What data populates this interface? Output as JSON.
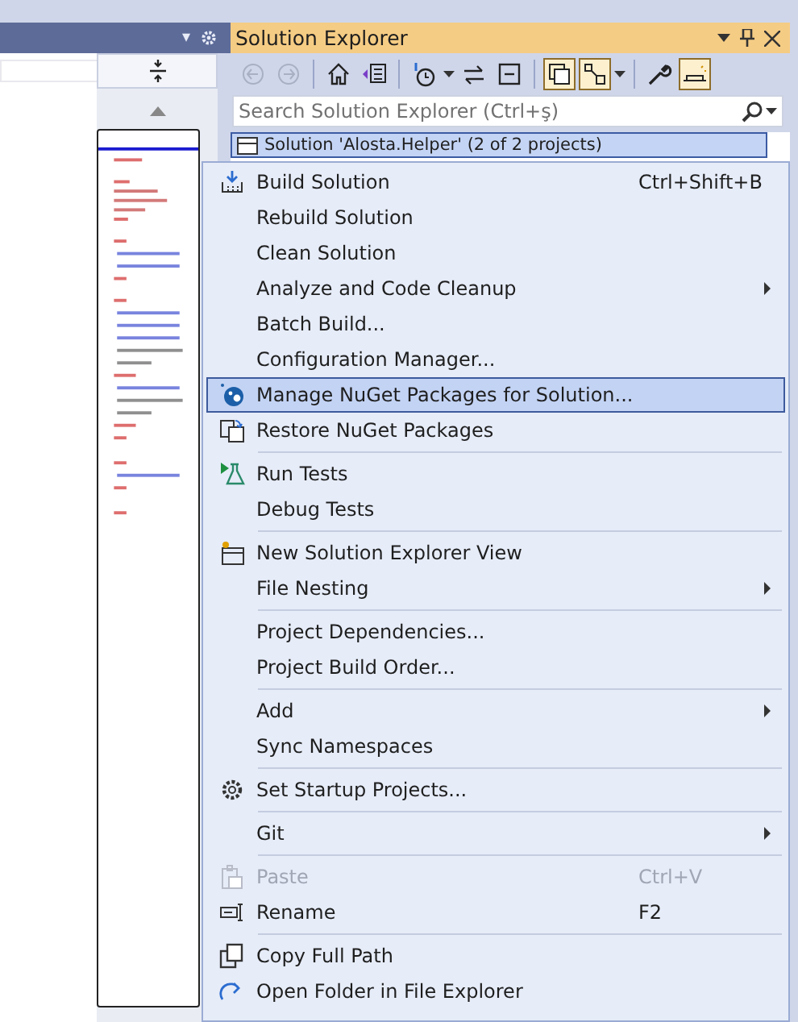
{
  "editor": {
    "tool_header": {
      "dropdown": "▾"
    }
  },
  "solution_explorer": {
    "title": "Solution Explorer",
    "toolbar": [
      {
        "kind": "back",
        "on": false,
        "disabled": true
      },
      {
        "kind": "forward",
        "on": false,
        "disabled": true
      },
      {
        "kind": "home",
        "on": false,
        "disabled": false
      },
      {
        "kind": "switch-views",
        "on": false,
        "disabled": false
      },
      {
        "kind": "history",
        "on": false,
        "disabled": false
      },
      {
        "kind": "sync",
        "on": false,
        "disabled": false
      },
      {
        "kind": "collapse",
        "on": false,
        "disabled": false
      },
      {
        "kind": "show-all",
        "on": true,
        "disabled": false
      },
      {
        "kind": "filter",
        "on": true,
        "disabled": false
      },
      {
        "kind": "properties",
        "on": false,
        "disabled": false
      },
      {
        "kind": "preview",
        "on": true,
        "disabled": false
      }
    ],
    "search": {
      "placeholder": "Search Solution Explorer (Ctrl+ş)"
    },
    "tree": [
      {
        "label": "Solution 'Alosta.Helper' (2 of 2 projects)",
        "selected": true
      }
    ]
  },
  "context_menu": {
    "items": [
      {
        "kind": "item",
        "label": "Build Solution",
        "shortcut": "Ctrl+Shift+B",
        "submenu": false,
        "disabled": false,
        "selected": false
      },
      {
        "kind": "item",
        "label": "Rebuild Solution",
        "submenu": false,
        "disabled": false,
        "selected": false
      },
      {
        "kind": "item",
        "label": "Clean Solution",
        "submenu": false,
        "disabled": false,
        "selected": false
      },
      {
        "kind": "item",
        "label": "Analyze and Code Cleanup",
        "submenu": true,
        "disabled": false,
        "selected": false
      },
      {
        "kind": "item",
        "label": "Batch Build...",
        "submenu": false,
        "disabled": false,
        "selected": false
      },
      {
        "kind": "item",
        "label": "Configuration Manager...",
        "submenu": false,
        "disabled": false,
        "selected": false
      },
      {
        "kind": "item",
        "label": "Manage NuGet Packages for Solution...",
        "submenu": false,
        "disabled": false,
        "selected": true
      },
      {
        "kind": "item",
        "label": "Restore NuGet Packages",
        "submenu": false,
        "disabled": false,
        "selected": false
      },
      {
        "kind": "separator"
      },
      {
        "kind": "item",
        "label": "Run Tests",
        "submenu": false,
        "disabled": false,
        "selected": false
      },
      {
        "kind": "item",
        "label": "Debug Tests",
        "submenu": false,
        "disabled": false,
        "selected": false
      },
      {
        "kind": "separator"
      },
      {
        "kind": "item",
        "label": "New Solution Explorer View",
        "submenu": false,
        "disabled": false,
        "selected": false
      },
      {
        "kind": "item",
        "label": "File Nesting",
        "submenu": true,
        "disabled": false,
        "selected": false
      },
      {
        "kind": "separator"
      },
      {
        "kind": "item",
        "label": "Project Dependencies...",
        "submenu": false,
        "disabled": false,
        "selected": false
      },
      {
        "kind": "item",
        "label": "Project Build Order...",
        "submenu": false,
        "disabled": false,
        "selected": false
      },
      {
        "kind": "separator"
      },
      {
        "kind": "item",
        "label": "Add",
        "submenu": true,
        "disabled": false,
        "selected": false
      },
      {
        "kind": "item",
        "label": "Sync Namespaces",
        "submenu": false,
        "disabled": false,
        "selected": false
      },
      {
        "kind": "separator"
      },
      {
        "kind": "item",
        "label": "Set Startup Projects...",
        "submenu": false,
        "disabled": false,
        "selected": false
      },
      {
        "kind": "separator"
      },
      {
        "kind": "item",
        "label": "Git",
        "submenu": true,
        "disabled": false,
        "selected": false
      },
      {
        "kind": "separator"
      },
      {
        "kind": "item",
        "label": "Paste",
        "shortcut": "Ctrl+V",
        "submenu": false,
        "disabled": true,
        "selected": false
      },
      {
        "kind": "item",
        "label": "Rename",
        "shortcut": "F2",
        "submenu": false,
        "disabled": false,
        "selected": false
      },
      {
        "kind": "separator"
      },
      {
        "kind": "item",
        "label": "Copy Full Path",
        "submenu": false,
        "disabled": false,
        "selected": false
      },
      {
        "kind": "item",
        "label": "Open Folder in File Explorer",
        "submenu": false,
        "disabled": false,
        "selected": false
      }
    ]
  }
}
